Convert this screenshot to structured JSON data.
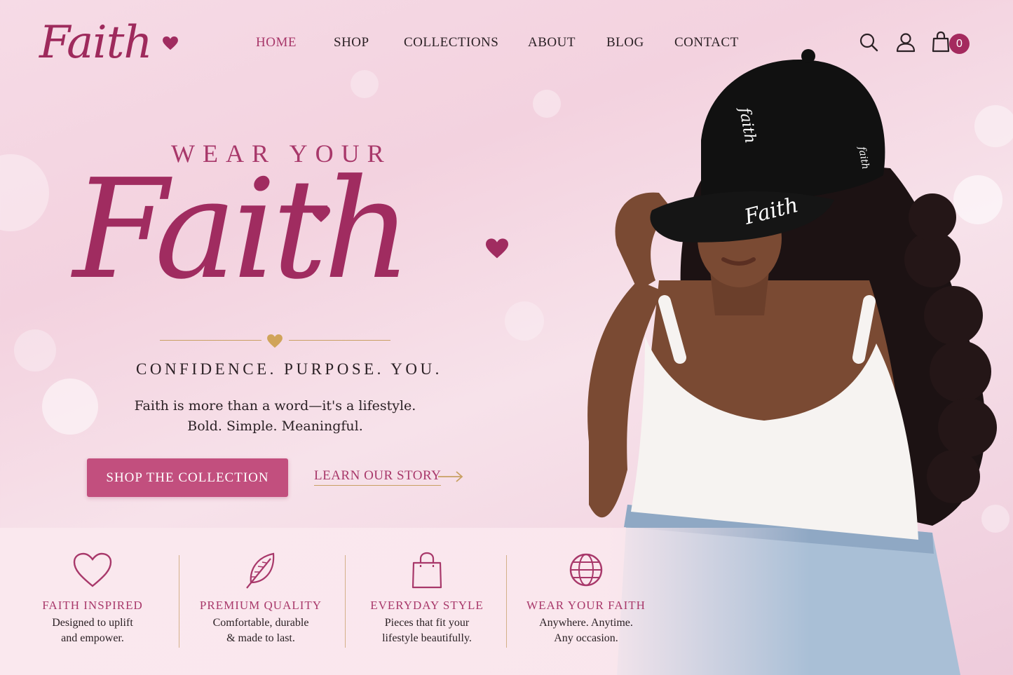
{
  "brand": {
    "logo_text": "Faith"
  },
  "nav": {
    "items": [
      {
        "label": "HOME",
        "active": true
      },
      {
        "label": "SHOP",
        "active": false
      },
      {
        "label": "COLLECTIONS",
        "active": false
      },
      {
        "label": "ABOUT",
        "active": false
      },
      {
        "label": "BLOG",
        "active": false
      },
      {
        "label": "CONTACT",
        "active": false
      }
    ]
  },
  "header_icons": {
    "search": "search-icon",
    "account": "user-icon",
    "cart": "shopping-bag-icon",
    "cart_count": "0"
  },
  "hero": {
    "kicker": "WEAR YOUR",
    "title": "Faith",
    "tagline": "CONFIDENCE. PURPOSE. YOU.",
    "description_line1": "Faith is more than a word—it's a lifestyle.",
    "description_line2": "Bold. Simple. Meaningful.",
    "primary_cta": "SHOP THE COLLECTION",
    "secondary_cta": "LEARN OUR STORY"
  },
  "photo": {
    "cap_text_front": "faith",
    "cap_text_brim": "Faith",
    "cap_text_side": "faith"
  },
  "features": [
    {
      "icon": "heart-icon",
      "title": "FAITH INSPIRED",
      "line1": "Designed to uplift",
      "line2": "and empower."
    },
    {
      "icon": "feather-icon",
      "title": "PREMIUM QUALITY",
      "line1": "Comfortable, durable",
      "line2": "& made to last."
    },
    {
      "icon": "shopping-bag-icon",
      "title": "EVERYDAY STYLE",
      "line1": "Pieces that fit your",
      "line2": "lifestyle beautifully."
    },
    {
      "icon": "globe-icon",
      "title": "WEAR YOUR FAITH",
      "line1": "Anywhere. Anytime.",
      "line2": "Any occasion."
    }
  ],
  "colors": {
    "accent": "#a8386a",
    "brand": "#a02c60",
    "button": "#c24f7e",
    "gold": "#c9a063",
    "background": "#f6dbe6"
  }
}
